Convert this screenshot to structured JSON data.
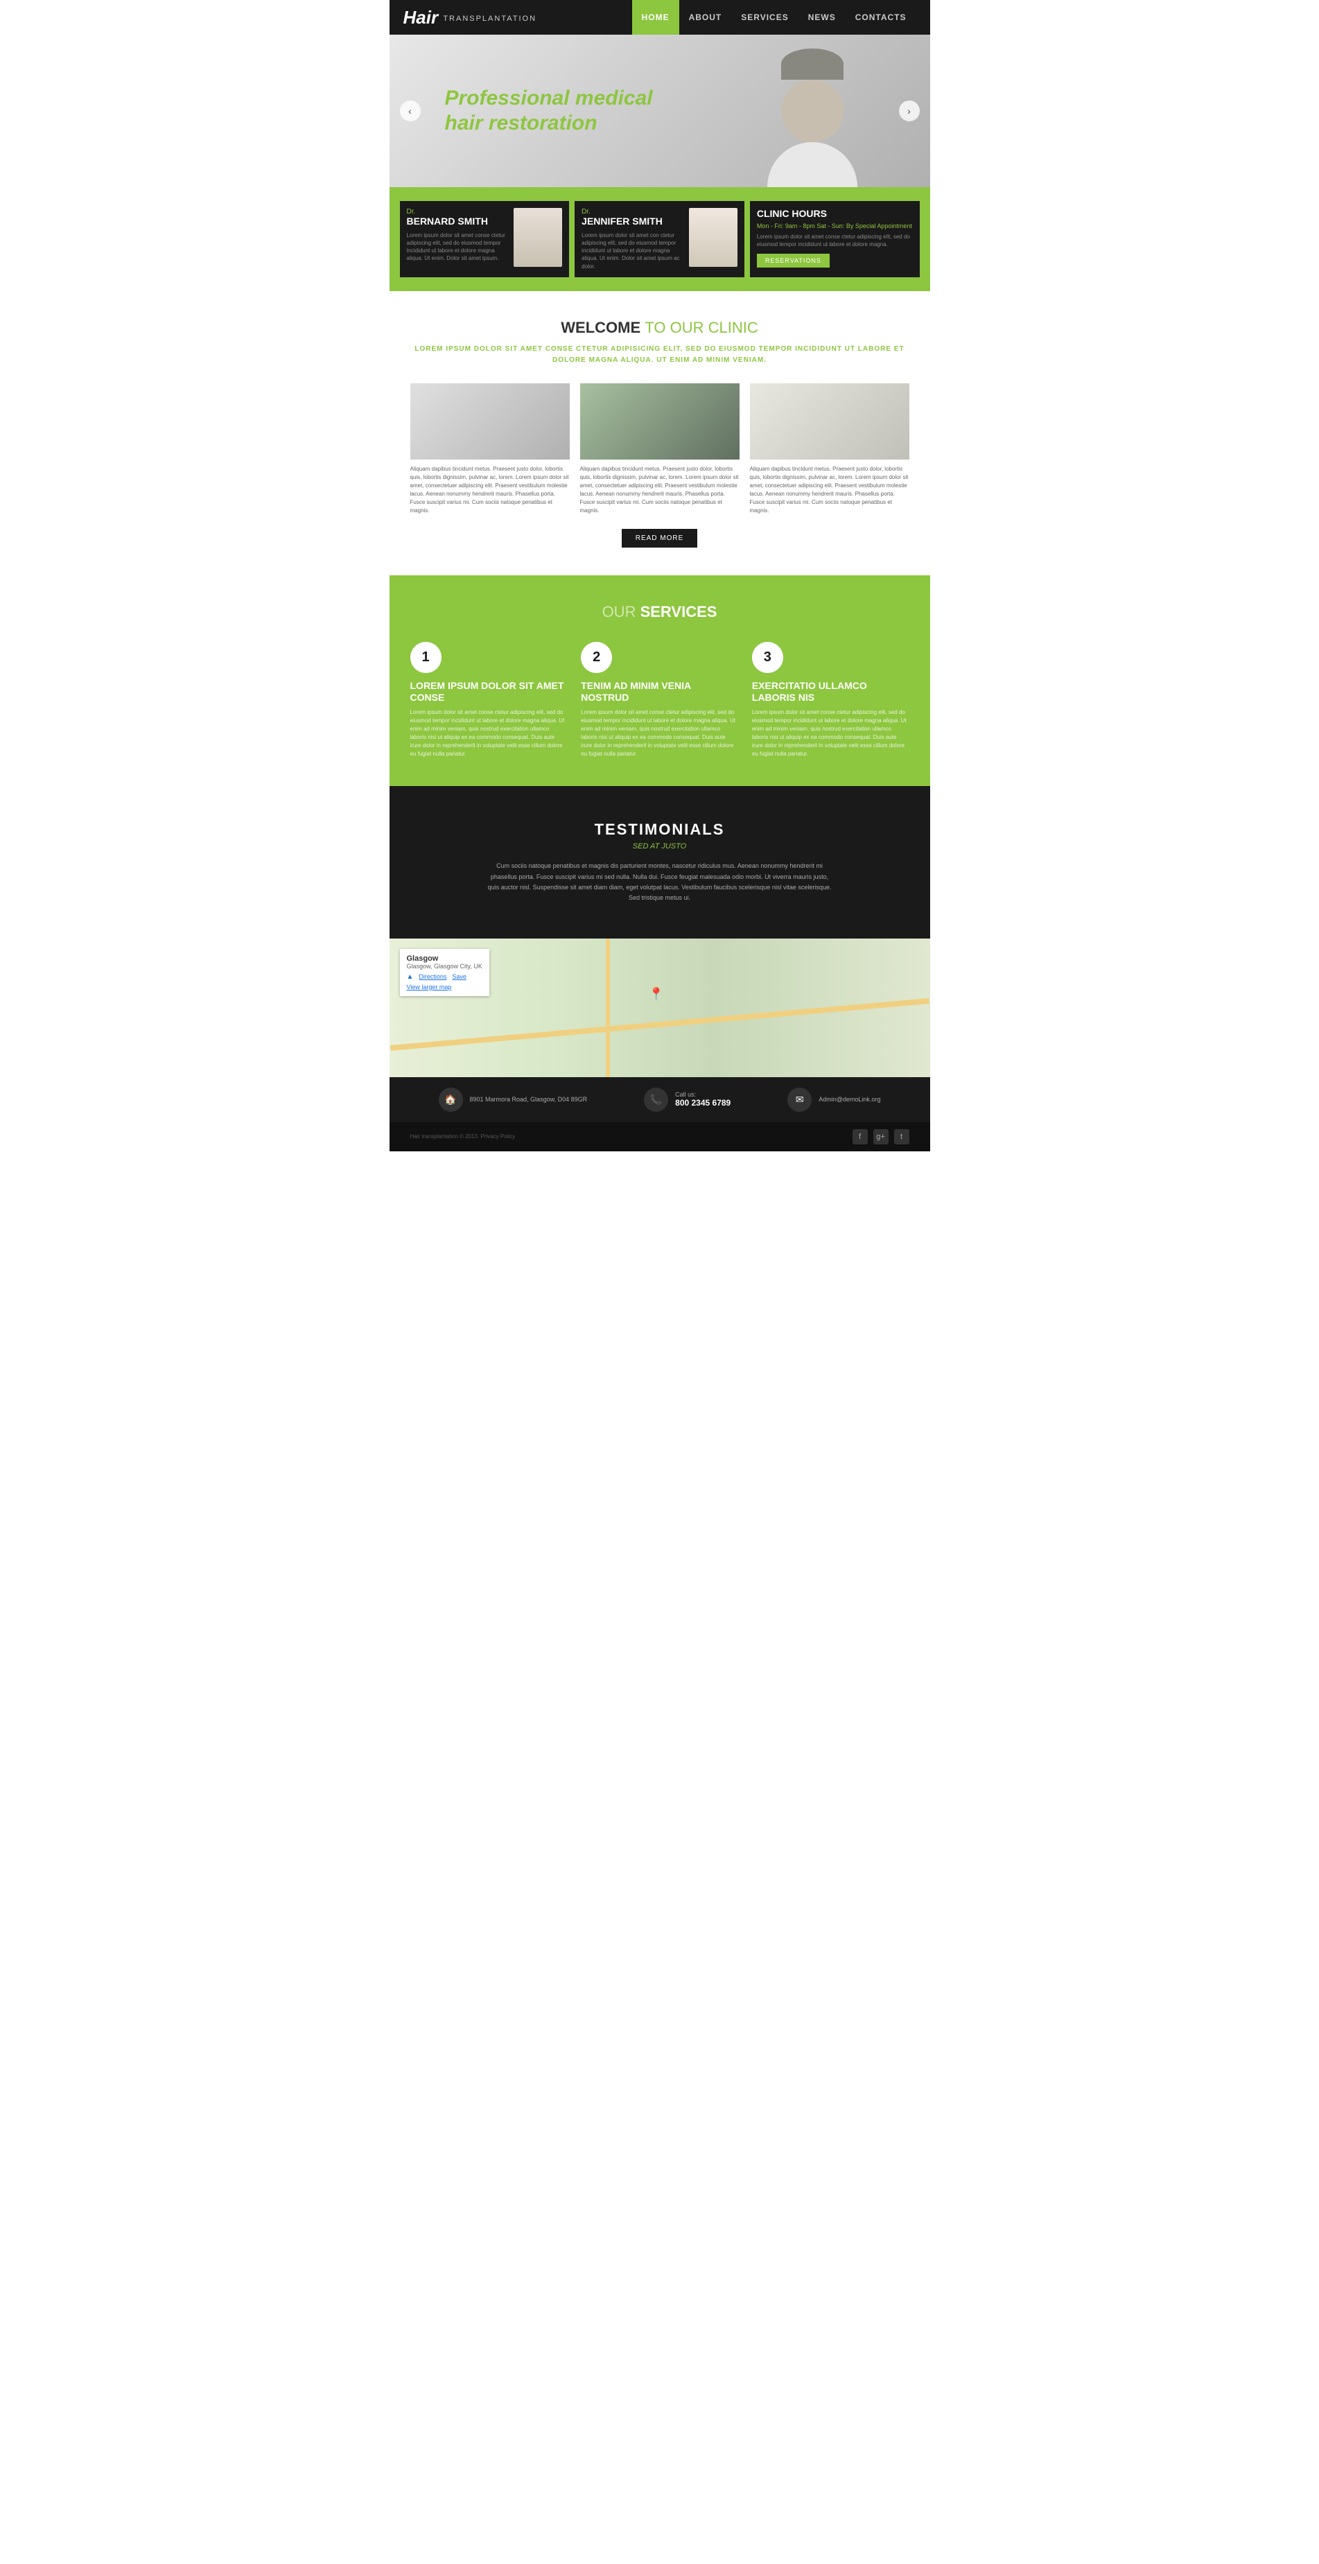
{
  "site": {
    "logo_hair": "Hair",
    "logo_transplant": "TRANSPLANTATION"
  },
  "nav": {
    "items": [
      {
        "label": "HOME",
        "active": true
      },
      {
        "label": "ABOUT",
        "active": false
      },
      {
        "label": "SERVICES",
        "active": false
      },
      {
        "label": "NEWS",
        "active": false
      },
      {
        "label": "CONTACTS",
        "active": false
      }
    ]
  },
  "hero": {
    "line1": "Professional medical",
    "line2": "hair restoration"
  },
  "doctors": {
    "doctor1": {
      "prefix": "Dr.",
      "name": "BERNARD SMITH",
      "text": "Lorem ipsum dolor sit amet conse ctetur adipiscing elit, sed do eiusmod tempor incididunt ut labore et dolore magna aliqua. Ut enim. Dolor sit amet ipsum."
    },
    "doctor2": {
      "prefix": "Dr.",
      "name": "JENNIFER SMITH",
      "text": "Lorem ipsum dolor sit amet con ctetur adipiscing elit, sed do eiusmod tempor incididunt ut labore et dolore magna aliqua. Ut enim. Dolor sit amet ipsum ac dolor."
    },
    "clinic": {
      "title": "CLINIC HOURS",
      "hours": "Mon - Fri: 9am - 8pm  Sat - Sun: By Special Appointment",
      "text": "Lorem ipsum dolor sit amet conse ctetur adipiscing elit, sed do eiusmod tempor incididunt ut labore et dolore magna.",
      "btn": "RESERVATIONS"
    }
  },
  "welcome": {
    "heading_bold": "WELCOME",
    "heading_light": "TO OUR CLINIC",
    "subtitle": "LOREM IPSUM DOLOR SIT AMET CONSE CTETUR ADIPISICING ELIT, SED DO EIUSMOD TEMPOR INCIDIDUNT UT\nLABORE ET DOLORE MAGNA ALIQUA. UT ENIM AD MINIM VENIAM.",
    "items": [
      {
        "text": "Aliquam dapibus tincidunt metus. Praesent justo dolor, lobortis quis, lobortis dignissim, pulvinar ac, lorem. Lorem ipsum dolor sit amet, consectetuer adipiscing elit. Praesent vestibulum molestie lacus. Aenean nonummy hendrerit mauris. Phasellus porta. Fusce suscipit varius mi. Cum sociis natoque penatibus et magnis."
      },
      {
        "text": "Aliquam dapibus tincidunt metus. Praesent justo dolor, lobortis quis, lobortis dignissim, pulvinar ac, lorem. Lorem ipsum dolor sit amet, consectetuer adipiscing elit. Praesent vestibulum molestie lacus. Aenean nonummy hendrerit mauris. Phasellus porta. Fusce suscipit varius mi. Cum sociis natoque penatibus et magnis."
      },
      {
        "text": "Aliquam dapibus tincidunt metus. Praesent justo dolor, lobortis quis, lobortis dignissim, pulvinar ac, lorem. Lorem ipsum dolor sit amet, consectetuer adipiscing elit. Praesent vestibulum molestie lacus. Aenean nonummy hendrerit mauris. Phasellus porta. Fusce suscipit varius mi. Cum sociis natoque penatibus et magnis."
      }
    ],
    "read_more": "READ MORE"
  },
  "services": {
    "heading_light": "OUR",
    "heading_bold": "SERVICES",
    "items": [
      {
        "number": "1",
        "name": "LOREM IPSUM DOLOR SIT AMET CONSE",
        "text": "Lorem ipsum dolor sit amet conse ctetur adipiscing elit, sed do eiusmod tempor incididunt ut labore et dolore magna aliqua. Ut enim ad minim veniam, quis nostrud exercitation ullamco laboris nisi ut aliquip ex ea commodo consequat. Duis aute irure dolor in reprehenderit in voluptate velit esse cillum dolore eu fugiat nulla pariatur."
      },
      {
        "number": "2",
        "name": "TENIM AD MINIM VENIA NOSTRUD",
        "text": "Lorem ipsum dolor sit amet conse ctetur adipiscing elit, sed do eiusmod tempor incididunt ut labore et dolore magna aliqua. Ut enim ad minim veniam, quis nostrud exercitation ullamco laboris nisi ut aliquip ex ea commodo consequat. Duis aute irure dolor in reprehenderit in voluptate velit esse cillum dolore eu fugiat nulla pariatur."
      },
      {
        "number": "3",
        "name": "EXERCITATIO ULLAMCO LABORIS NIS",
        "text": "Lorem ipsum dolor sit amet conse ctetur adipiscing elit, sed do eiusmod tempor incididunt ut labore et dolore magna aliqua. Ut enim ad minim veniam, quis nostrud exercitation ullamco laboris nisi ut aliquip ex ea commodo consequat. Duis aute irure dolor in reprehenderit in voluptate velit esse cillum dolore eu fugiat nulla pariatur."
      }
    ]
  },
  "testimonials": {
    "title": "TESTIMONIALS",
    "subtitle": "SED AT JUSTO",
    "text": "Cum sociis natoque penatibus et magnis dis parturient montes, nascetur ridiculus mus. Aenean nonummy hendrerit mi phasellus porta. Fusce suscipit varius mi sed nulla. Nulla dui. Fusce feugiat malesuada odio morbi. Ut viverra mauris justo, quis auctor nisl. Suspendisse sit amet diam diam, eget volutpat lacus. Vestibulum faucibus scelerisque nisl vitae scelerisque. Sed tristique metus ui."
  },
  "map": {
    "city": "Glasgow",
    "region": "Glasgow, Glasgow City, UK",
    "directions_label": "Directions",
    "save_label": "Save",
    "larger_label": "View larger map"
  },
  "footer": {
    "address_icon": "🏠",
    "address": "8901 Marmora Road, Glasgow, D04 89GR",
    "phone_icon": "📞",
    "phone_label": "Call us:",
    "phone": "800 2345 6789",
    "email_icon": "✉",
    "email": "Admin@demoLink.org",
    "copy": "Hair transplantation © 2013. Privacy Policy",
    "social": [
      "f",
      "g+",
      "t"
    ]
  }
}
